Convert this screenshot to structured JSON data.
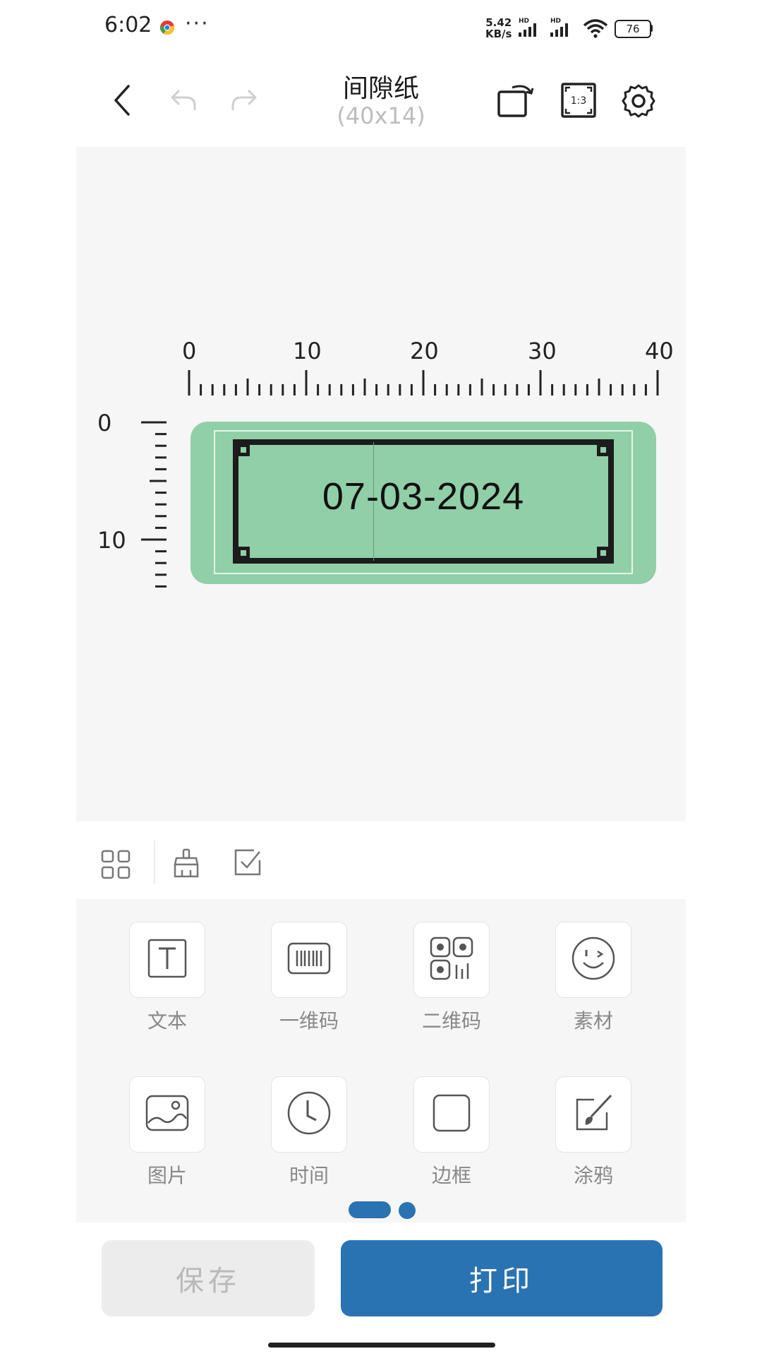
{
  "status_bar": {
    "time": "6:02",
    "more": "···",
    "net_speed_value": "5.42",
    "net_speed_unit": "KB/s",
    "battery": "76",
    "icons": [
      "chrome-icon",
      "signal-icon",
      "wifi-icon",
      "battery-icon"
    ]
  },
  "header": {
    "title": "间隙纸",
    "subtitle": "(40x14)",
    "zoom_icon_text": "1:3",
    "icons": [
      "back-icon",
      "undo-icon",
      "redo-icon",
      "rotate-icon",
      "zoom-icon",
      "settings-icon"
    ]
  },
  "canvas": {
    "ruler_top": [
      "0",
      "10",
      "20",
      "30",
      "40"
    ],
    "ruler_left": [
      "0",
      "10"
    ],
    "label_text": "07-03-2024",
    "label_color": "#90cfa7"
  },
  "toolbar": {
    "icons": [
      "grid-icon",
      "clear-brush-icon",
      "multi-select-icon"
    ]
  },
  "tools": [
    {
      "label": "文本",
      "icon": "text-icon"
    },
    {
      "label": "一维码",
      "icon": "barcode-icon"
    },
    {
      "label": "二维码",
      "icon": "qrcode-icon"
    },
    {
      "label": "素材",
      "icon": "sticker-face-icon"
    },
    {
      "label": "图片",
      "icon": "image-icon"
    },
    {
      "label": "时间",
      "icon": "clock-icon"
    },
    {
      "label": "边框",
      "icon": "border-icon"
    },
    {
      "label": "涂鸦",
      "icon": "doodle-brush-icon"
    }
  ],
  "buttons": {
    "save": "保存",
    "print": "打印"
  },
  "colors": {
    "accent": "#2a73b2",
    "label_green": "#90cfa7",
    "canvas_bg": "#f6f6f6"
  }
}
